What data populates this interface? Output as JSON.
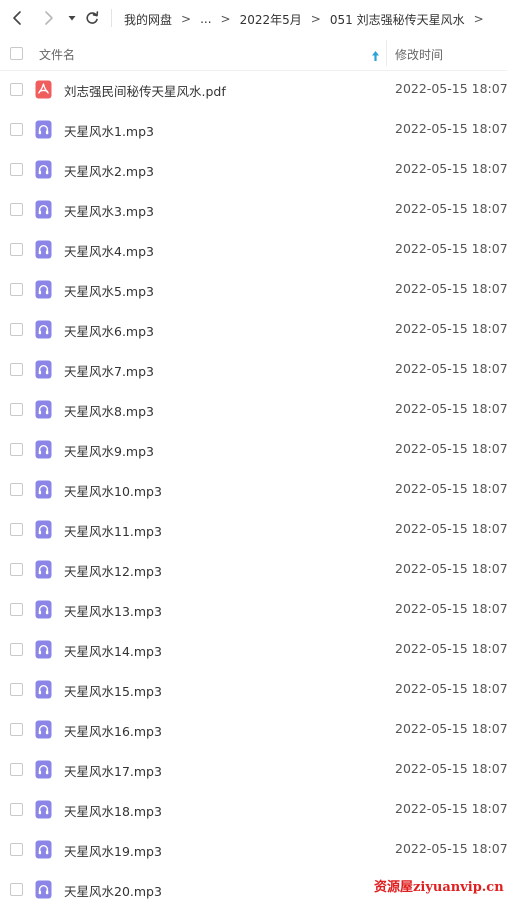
{
  "breadcrumb": {
    "items": [
      "我的网盘",
      "...",
      "2022年5月",
      "051 刘志强秘传天星风水"
    ],
    "separator": ">"
  },
  "table": {
    "columns": {
      "name": "文件名",
      "modified": "修改时间"
    },
    "sort": "ascending"
  },
  "files": [
    {
      "name": "刘志强民间秘传天星风水.pdf",
      "modified": "2022-05-15 18:07",
      "icon": "pdf-icon"
    },
    {
      "name": "天星风水1.mp3",
      "modified": "2022-05-15 18:07",
      "icon": "audio-file-icon"
    },
    {
      "name": "天星风水2.mp3",
      "modified": "2022-05-15 18:07",
      "icon": "audio-file-icon"
    },
    {
      "name": "天星风水3.mp3",
      "modified": "2022-05-15 18:07",
      "icon": "audio-file-icon"
    },
    {
      "name": "天星风水4.mp3",
      "modified": "2022-05-15 18:07",
      "icon": "audio-file-icon"
    },
    {
      "name": "天星风水5.mp3",
      "modified": "2022-05-15 18:07",
      "icon": "audio-file-icon"
    },
    {
      "name": "天星风水6.mp3",
      "modified": "2022-05-15 18:07",
      "icon": "audio-file-icon"
    },
    {
      "name": "天星风水7.mp3",
      "modified": "2022-05-15 18:07",
      "icon": "audio-file-icon"
    },
    {
      "name": "天星风水8.mp3",
      "modified": "2022-05-15 18:07",
      "icon": "audio-file-icon"
    },
    {
      "name": "天星风水9.mp3",
      "modified": "2022-05-15 18:07",
      "icon": "audio-file-icon"
    },
    {
      "name": "天星风水10.mp3",
      "modified": "2022-05-15 18:07",
      "icon": "audio-file-icon"
    },
    {
      "name": "天星风水11.mp3",
      "modified": "2022-05-15 18:07",
      "icon": "audio-file-icon"
    },
    {
      "name": "天星风水12.mp3",
      "modified": "2022-05-15 18:07",
      "icon": "audio-file-icon"
    },
    {
      "name": "天星风水13.mp3",
      "modified": "2022-05-15 18:07",
      "icon": "audio-file-icon"
    },
    {
      "name": "天星风水14.mp3",
      "modified": "2022-05-15 18:07",
      "icon": "audio-file-icon"
    },
    {
      "name": "天星风水15.mp3",
      "modified": "2022-05-15 18:07",
      "icon": "audio-file-icon"
    },
    {
      "name": "天星风水16.mp3",
      "modified": "2022-05-15 18:07",
      "icon": "audio-file-icon"
    },
    {
      "name": "天星风水17.mp3",
      "modified": "2022-05-15 18:07",
      "icon": "audio-file-icon"
    },
    {
      "name": "天星风水18.mp3",
      "modified": "2022-05-15 18:07",
      "icon": "audio-file-icon"
    },
    {
      "name": "天星风水19.mp3",
      "modified": "2022-05-15 18:07",
      "icon": "audio-file-icon"
    },
    {
      "name": "天星风水20.mp3",
      "modified": "",
      "icon": "audio-file-icon"
    }
  ],
  "watermark": "资源屋ziyuanvip.cn",
  "colors": {
    "audio_icon": "#8a85e6",
    "pdf_icon": "#ef5d5d",
    "sort_arrow": "#2aa3d6",
    "watermark": "#e02020"
  }
}
